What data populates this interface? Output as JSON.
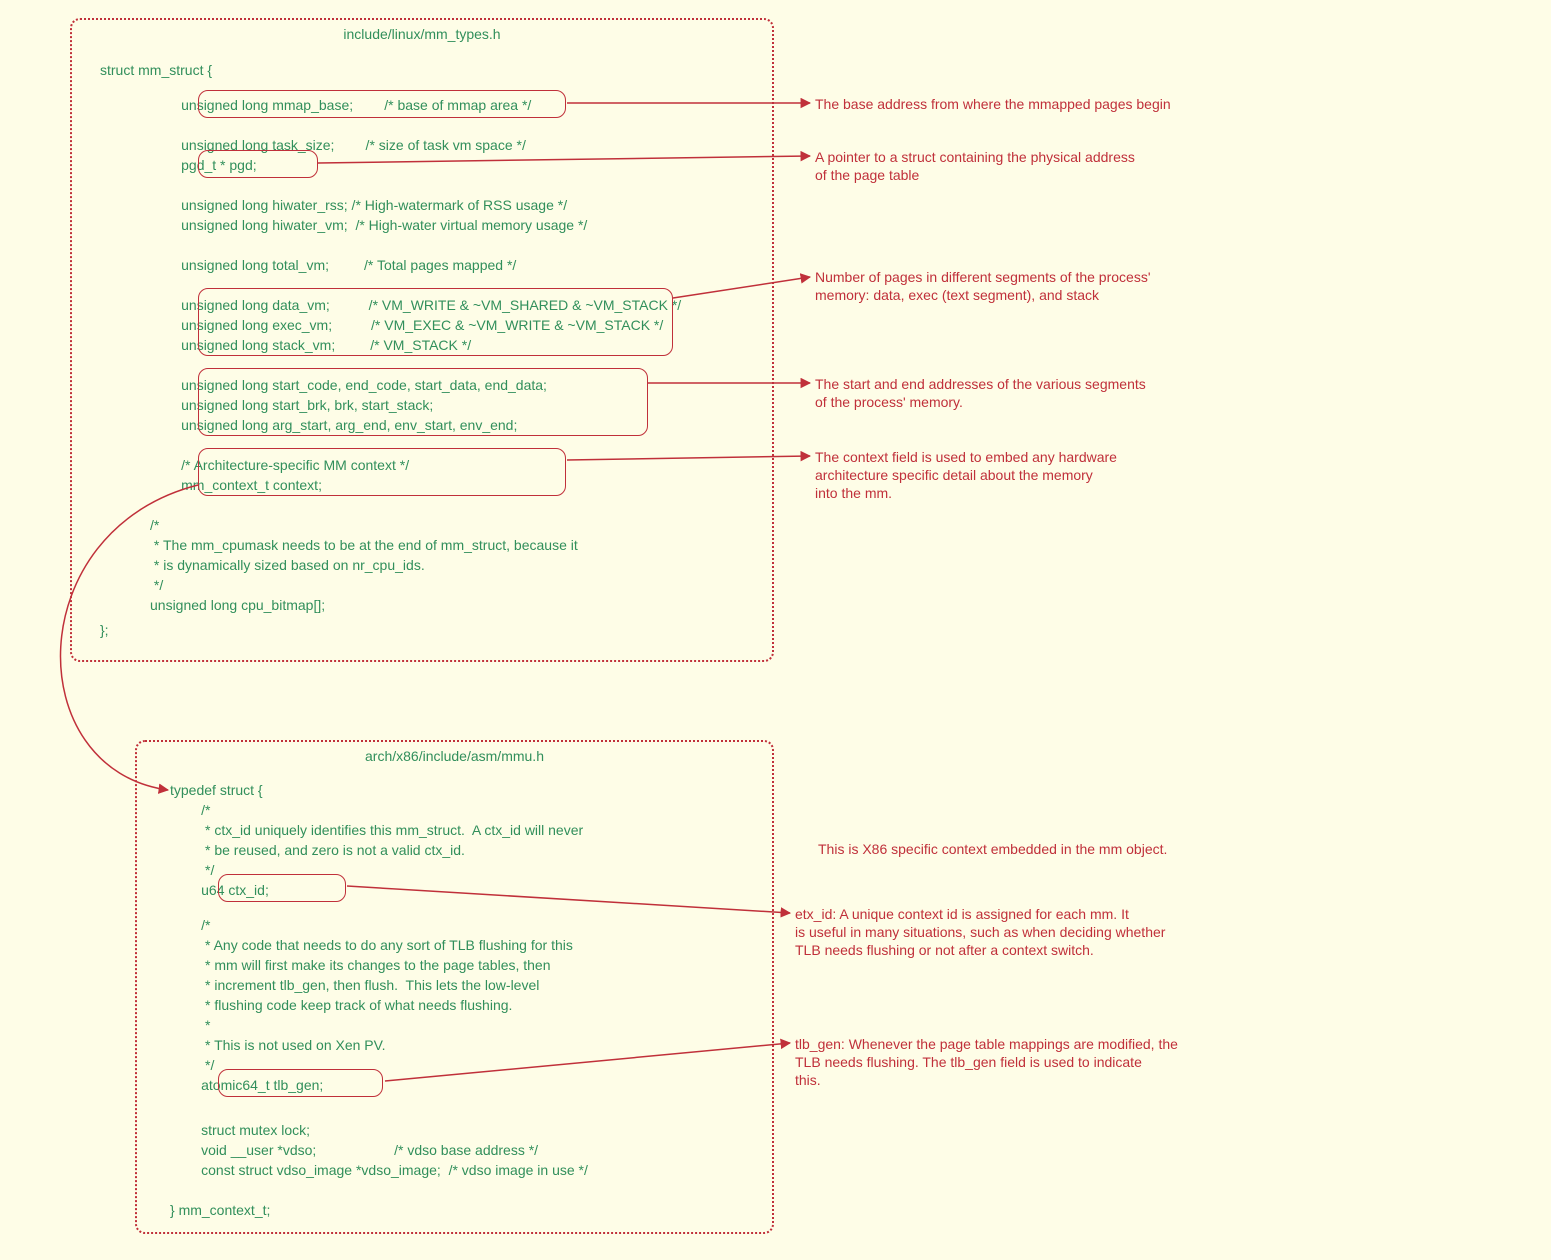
{
  "boxes": {
    "top": {
      "title": "include/linux/mm_types.h"
    },
    "bottom": {
      "title": "arch/x86/include/asm/mmu.h"
    }
  },
  "code": {
    "struct_open": "struct mm_struct {",
    "mmap_base": "        unsigned long mmap_base;        /* base of mmap area */",
    "task_size": "        unsigned long task_size;        /* size of task vm space */",
    "pgd": "        pgd_t * pgd;",
    "hiwater_rss": "        unsigned long hiwater_rss; /* High-watermark of RSS usage */",
    "hiwater_vm": "        unsigned long hiwater_vm;  /* High-water virtual memory usage */",
    "total_vm": "        unsigned long total_vm;         /* Total pages mapped */",
    "data_vm": "        unsigned long data_vm;          /* VM_WRITE & ~VM_SHARED & ~VM_STACK */",
    "exec_vm": "        unsigned long exec_vm;          /* VM_EXEC & ~VM_WRITE & ~VM_STACK */",
    "stack_vm": "        unsigned long stack_vm;         /* VM_STACK */",
    "seg1": "        unsigned long start_code, end_code, start_data, end_data;",
    "seg2": "        unsigned long start_brk, brk, start_stack;",
    "seg3": "        unsigned long arg_start, arg_end, env_start, env_end;",
    "ctx_c": "        /* Architecture-specific MM context */",
    "ctx": "        mm_context_t context;",
    "tail_c": "/*\n * The mm_cpumask needs to be at the end of mm_struct, because it\n * is dynamically sized based on nr_cpu_ids.\n */\nunsigned long cpu_bitmap[];",
    "struct_close": "};",
    "td_open": "typedef struct {",
    "ctxid_c": "        /*\n         * ctx_id uniquely identifies this mm_struct.  A ctx_id will never\n         * be reused, and zero is not a valid ctx_id.\n         */",
    "ctxid": "        u64 ctx_id;",
    "tlb_c": "        /*\n         * Any code that needs to do any sort of TLB flushing for this\n         * mm will first make its changes to the page tables, then\n         * increment tlb_gen, then flush.  This lets the low-level\n         * flushing code keep track of what needs flushing.\n         *\n         * This is not used on Xen PV.\n         */",
    "tlb": "        atomic64_t tlb_gen;",
    "lock": "        struct mutex lock;",
    "vdso": "        void __user *vdso;                    /* vdso base address */",
    "vdso_img": "        const struct vdso_image *vdso_image;  /* vdso image in use */",
    "td_close": "} mm_context_t;"
  },
  "annotations": {
    "mmap_base": "The base address from where the mmapped pages begin",
    "pgd": "A pointer to a struct containing the physical address\nof the page table",
    "vm": "Number of pages in different segments of the process'\nmemory: data, exec (text segment), and stack",
    "seg": "The start and end addresses of the various segments\nof the process' memory.",
    "ctx": "The context field is used to embed any hardware\narchitecture specific detail about the memory\ninto the mm.",
    "x86": "This is X86 specific context embedded in the mm object.",
    "ctxid": "etx_id: A unique context id is assigned for each mm. It\nis useful in many situations, such as when deciding whether\nTLB needs flushing or not after a context switch.",
    "tlb": "tlb_gen: Whenever the page table mappings are modified, the\nTLB needs flushing. The tlb_gen field is used to indicate\nthis."
  }
}
